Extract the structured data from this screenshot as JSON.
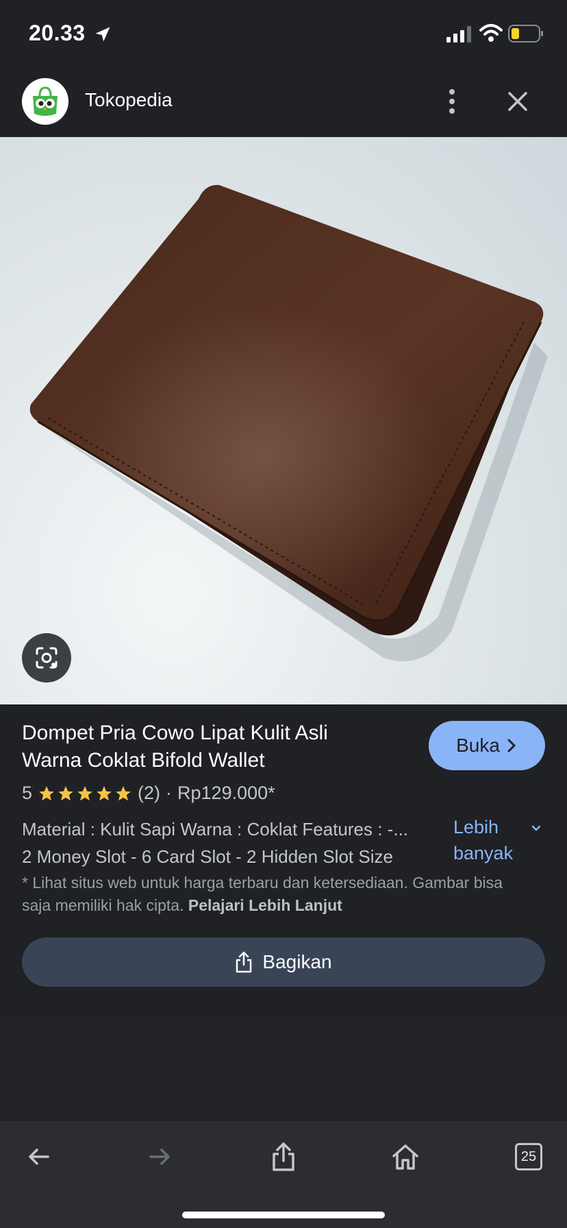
{
  "status_bar": {
    "time": "20.33"
  },
  "header": {
    "site_name": "Tokopedia"
  },
  "product": {
    "title": "Dompet Pria Cowo Lipat Kulit Asli Warna Coklat Bifold Wallet",
    "open_label": "Buka",
    "rating": "5",
    "review_count": "(2)",
    "separator": "·",
    "price": "Rp129.000*",
    "description_line1": "Material : Kulit Sapi Warna : Coklat Features : -...",
    "description_line2": "2 Money Slot - 6 Card Slot - 2 Hidden Slot Size",
    "more_label": "Lebih banyak",
    "note_text": "* Lihat situs web untuk harga terbaru dan ketersediaan. Gambar bisa saja memiliki hak cipta.",
    "note_link": "Pelajari Lebih Lanjut",
    "share_label": "Bagikan"
  },
  "toolbar": {
    "tab_count": "25"
  },
  "colors": {
    "background": "#1f2125",
    "accent": "#8ab4f8",
    "share_button": "#394457",
    "star": "#f6c344",
    "battery_low": "#f7d22e"
  }
}
